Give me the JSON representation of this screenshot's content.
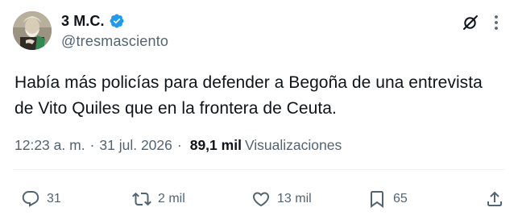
{
  "author": {
    "display_name": "3 M.C.",
    "handle": "@tresmasciento",
    "verified": true
  },
  "tweet": {
    "text_line1": "Había más policías para defender a Begoña de una entrevista",
    "text_line2": "de Vito Quiles que en la frontera de Ceuta."
  },
  "meta": {
    "time": "12:23 a. m.",
    "separator": "·",
    "date": "31 jul. 2026",
    "views_count": "89,1 mil",
    "views_label": "Visualizaciones"
  },
  "actions": {
    "replies": "31",
    "reposts": "2 mil",
    "likes": "13 mil",
    "bookmarks": "65"
  },
  "colors": {
    "text_primary": "#0f1419",
    "text_secondary": "#536471",
    "verified_blue": "#1d9bf0",
    "divider": "#eff3f4"
  },
  "icons": {
    "reply": "speech-bubble-icon",
    "repost": "repost-arrows-icon",
    "like": "heart-icon",
    "bookmark": "bookmark-icon",
    "share": "share-upload-icon",
    "grok": "grok-icon",
    "more": "more-dots-icon"
  }
}
